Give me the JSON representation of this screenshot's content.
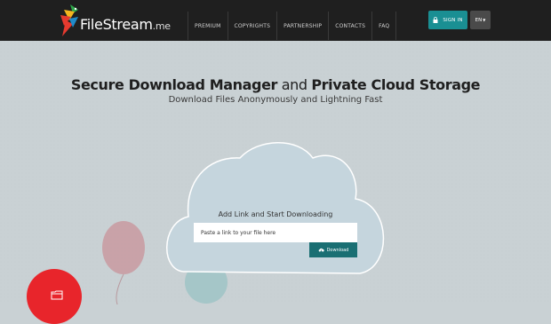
{
  "header": {
    "logo": {
      "name": "FileStream",
      "tld": ".me"
    },
    "nav": [
      {
        "label": "PREMIUM"
      },
      {
        "label": "COPYRIGHTS"
      },
      {
        "label": "PARTNERSHIP"
      },
      {
        "label": "CONTACTS"
      },
      {
        "label": "FAQ"
      }
    ],
    "sign_in_label": "SIGN IN",
    "language": "EN"
  },
  "hero": {
    "title_part1": "Secure Download Manager",
    "title_mid": "and",
    "title_part2": "Private Cloud Storage",
    "subtitle": "Download Files Anonymously and Lightning Fast"
  },
  "cloud": {
    "heading": "Add Link and Start Downloading",
    "input_placeholder": "Paste a link to your file here",
    "input_value": "",
    "button_label": "Download"
  },
  "colors": {
    "header_bg": "#1f1f1f",
    "accent_teal": "#1a8f93",
    "button_dark_teal": "#1a6f73",
    "page_bg": "#c9d1d4",
    "badge_red": "#e8252b"
  },
  "icons": [
    "parrot-logo-icon",
    "lock-icon",
    "caret-down-icon",
    "cloud-download-icon",
    "folder-icon"
  ]
}
